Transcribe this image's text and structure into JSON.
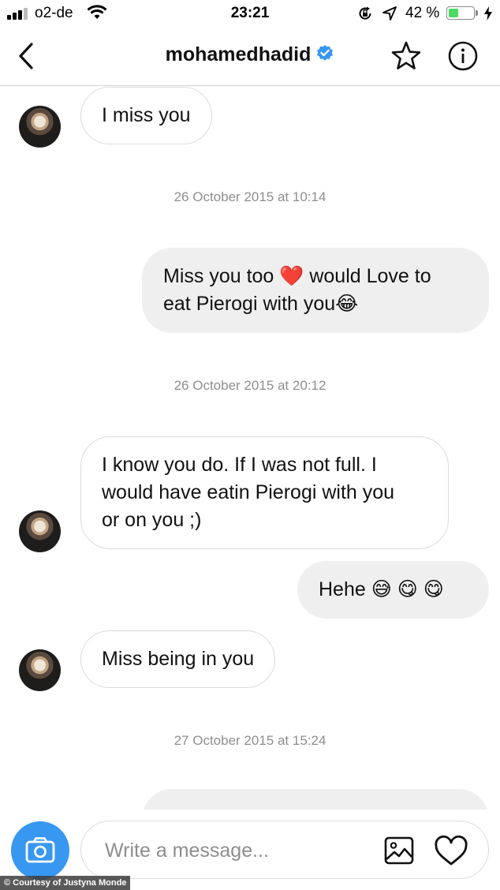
{
  "status_bar": {
    "carrier": "o2-de",
    "time": "23:21",
    "battery_percent": "42 %",
    "battery_level": 0.42,
    "battery_color": "#4cd964",
    "icons": [
      "signal-icon",
      "wifi-icon",
      "rotation-lock-icon",
      "location-arrow-icon",
      "battery-icon",
      "charging-bolt-icon"
    ]
  },
  "header": {
    "username": "mohamedhadid",
    "icons": [
      "back-chevron-icon",
      "verified-badge-icon",
      "star-icon",
      "info-icon"
    ],
    "verified_color": "#3897f0"
  },
  "messages": [
    {
      "type": "incoming",
      "lines": [
        "I miss you"
      ],
      "avatar": "contact-avatar"
    },
    {
      "type": "timestamp",
      "text": "26 October 2015 at 10:14"
    },
    {
      "type": "outgoing",
      "lines": [
        "Miss you too ❤️ would Love to",
        "eat Pierogi with you😂"
      ]
    },
    {
      "type": "timestamp",
      "text": "26 October 2015 at 20:12"
    },
    {
      "type": "incoming",
      "lines": [
        "I know you do. If I was not full. I",
        "would have eatin Pierogi with you",
        "or on you ;)"
      ],
      "avatar": "contact-avatar"
    },
    {
      "type": "outgoing",
      "lines": [
        "Hehe 😅 😋 😋"
      ]
    },
    {
      "type": "incoming",
      "lines": [
        "Miss being in you"
      ],
      "avatar": "contact-avatar"
    },
    {
      "type": "timestamp",
      "text": "27 October 2015 at 15:24"
    },
    {
      "type": "outgoing",
      "lines": [
        ""
      ]
    }
  ],
  "composer": {
    "placeholder": "Write a message...",
    "value": "",
    "icons": [
      "camera-icon",
      "gallery-icon",
      "heart-icon"
    ],
    "camera_color": "#3897f0"
  },
  "credit": "© Courtesy of Justyna Monde",
  "colors": {
    "incoming_border": "#dbdbdb",
    "outgoing_bg": "#efefef",
    "timestamp": "#8e8e8e"
  }
}
